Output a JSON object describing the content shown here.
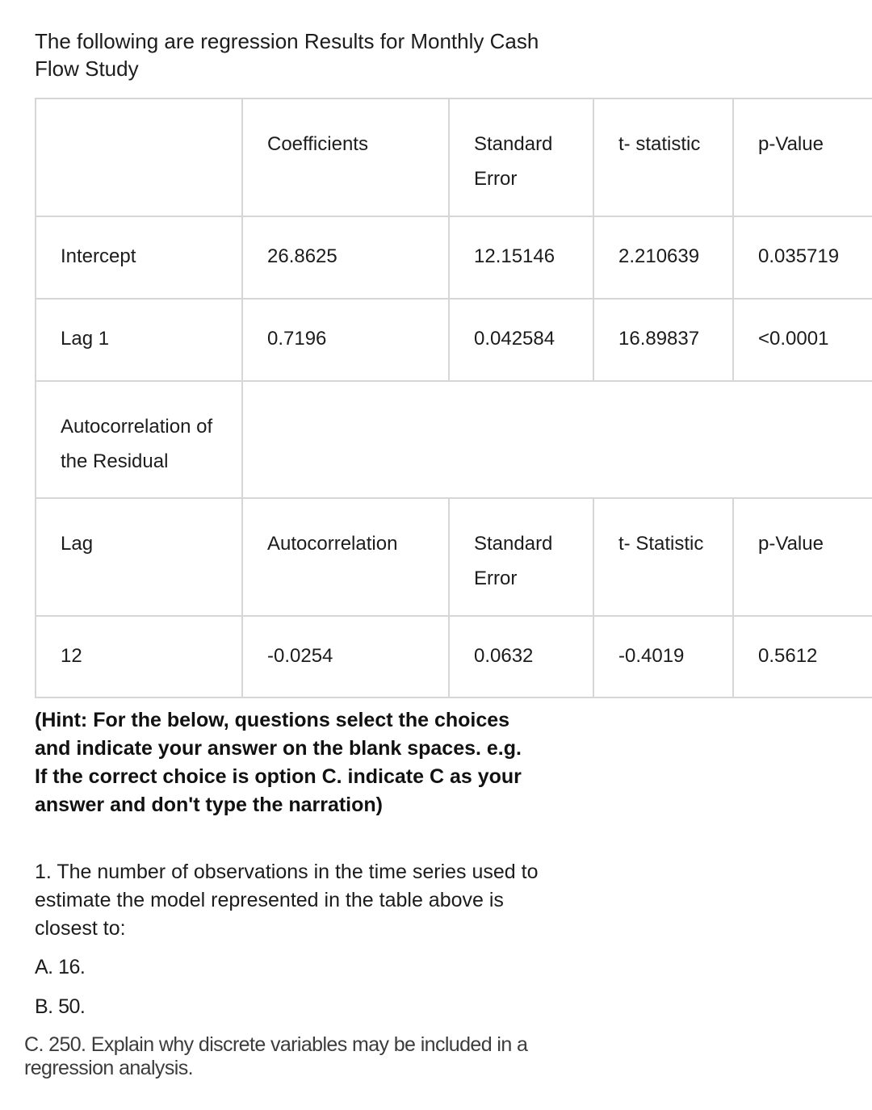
{
  "title": "The following are regression Results for Monthly Cash Flow Study",
  "table": {
    "header": [
      "",
      "Coefficients",
      "Standard Error",
      "t- statistic",
      "p-Value"
    ],
    "rows": [
      [
        "Intercept",
        "26.8625",
        "12.15146",
        "2.210639",
        "0.035719"
      ],
      [
        "Lag 1",
        "0.7196",
        "0.042584",
        "16.89837",
        "<0.0001"
      ]
    ],
    "section_label": "Autocorrelation of the Residual",
    "header2": [
      "Lag",
      "Autocorrelation",
      "Standard Error",
      "t- Statistic",
      "p-Value"
    ],
    "rows2": [
      [
        "12",
        "-0.0254",
        "0.0632",
        "-0.4019",
        "0.5612"
      ]
    ]
  },
  "hint": "(Hint: For the below, questions select the choices and indicate your answer on the blank spaces. e.g. If the correct choice is option C. indicate C as your answer and don't type the narration)",
  "question": {
    "text": "1. The number of observations in the time series used to estimate the model represented in the table above is closest to:",
    "options": [
      "A. 16.",
      "B. 50.",
      "C. 250. Explain why discrete variables may be included in a regression analysis."
    ]
  }
}
